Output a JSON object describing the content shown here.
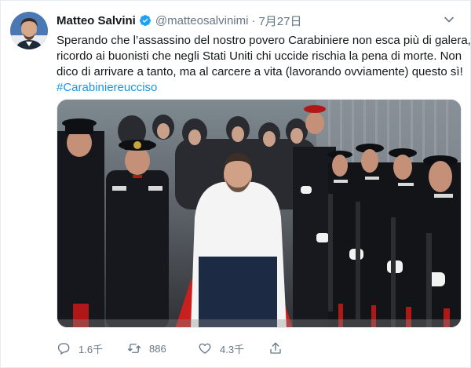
{
  "tweet": {
    "author": {
      "display_name": "Matteo Salvini",
      "handle": "@matteosalvinimi",
      "verified": true
    },
    "date": "7月27日",
    "separator": "·",
    "text_lines": [
      "Sperando che l’assassino del nostro povero Carabiniere non esca più di galera,",
      "ricordo ai buonisti che negli Stati Uniti chi uccide rischia la pena di morte. Non",
      "dico di arrivare a tanto, ma al carcere a vita (lavorando ovviamente) questo sì!"
    ],
    "hashtag": "#Carabiniereucciso",
    "actions": {
      "reply": {
        "icon": "reply-icon",
        "count": "1.6千"
      },
      "retweet": {
        "icon": "retweet-icon",
        "count": "886"
      },
      "like": {
        "icon": "heart-icon",
        "count": "4.3千"
      },
      "share": {
        "icon": "share-icon"
      }
    }
  },
  "colors": {
    "text": "#14171a",
    "secondary": "#657786",
    "link": "#1b95e0",
    "verified": "#1da1f2",
    "border": "#e6ecf0"
  }
}
